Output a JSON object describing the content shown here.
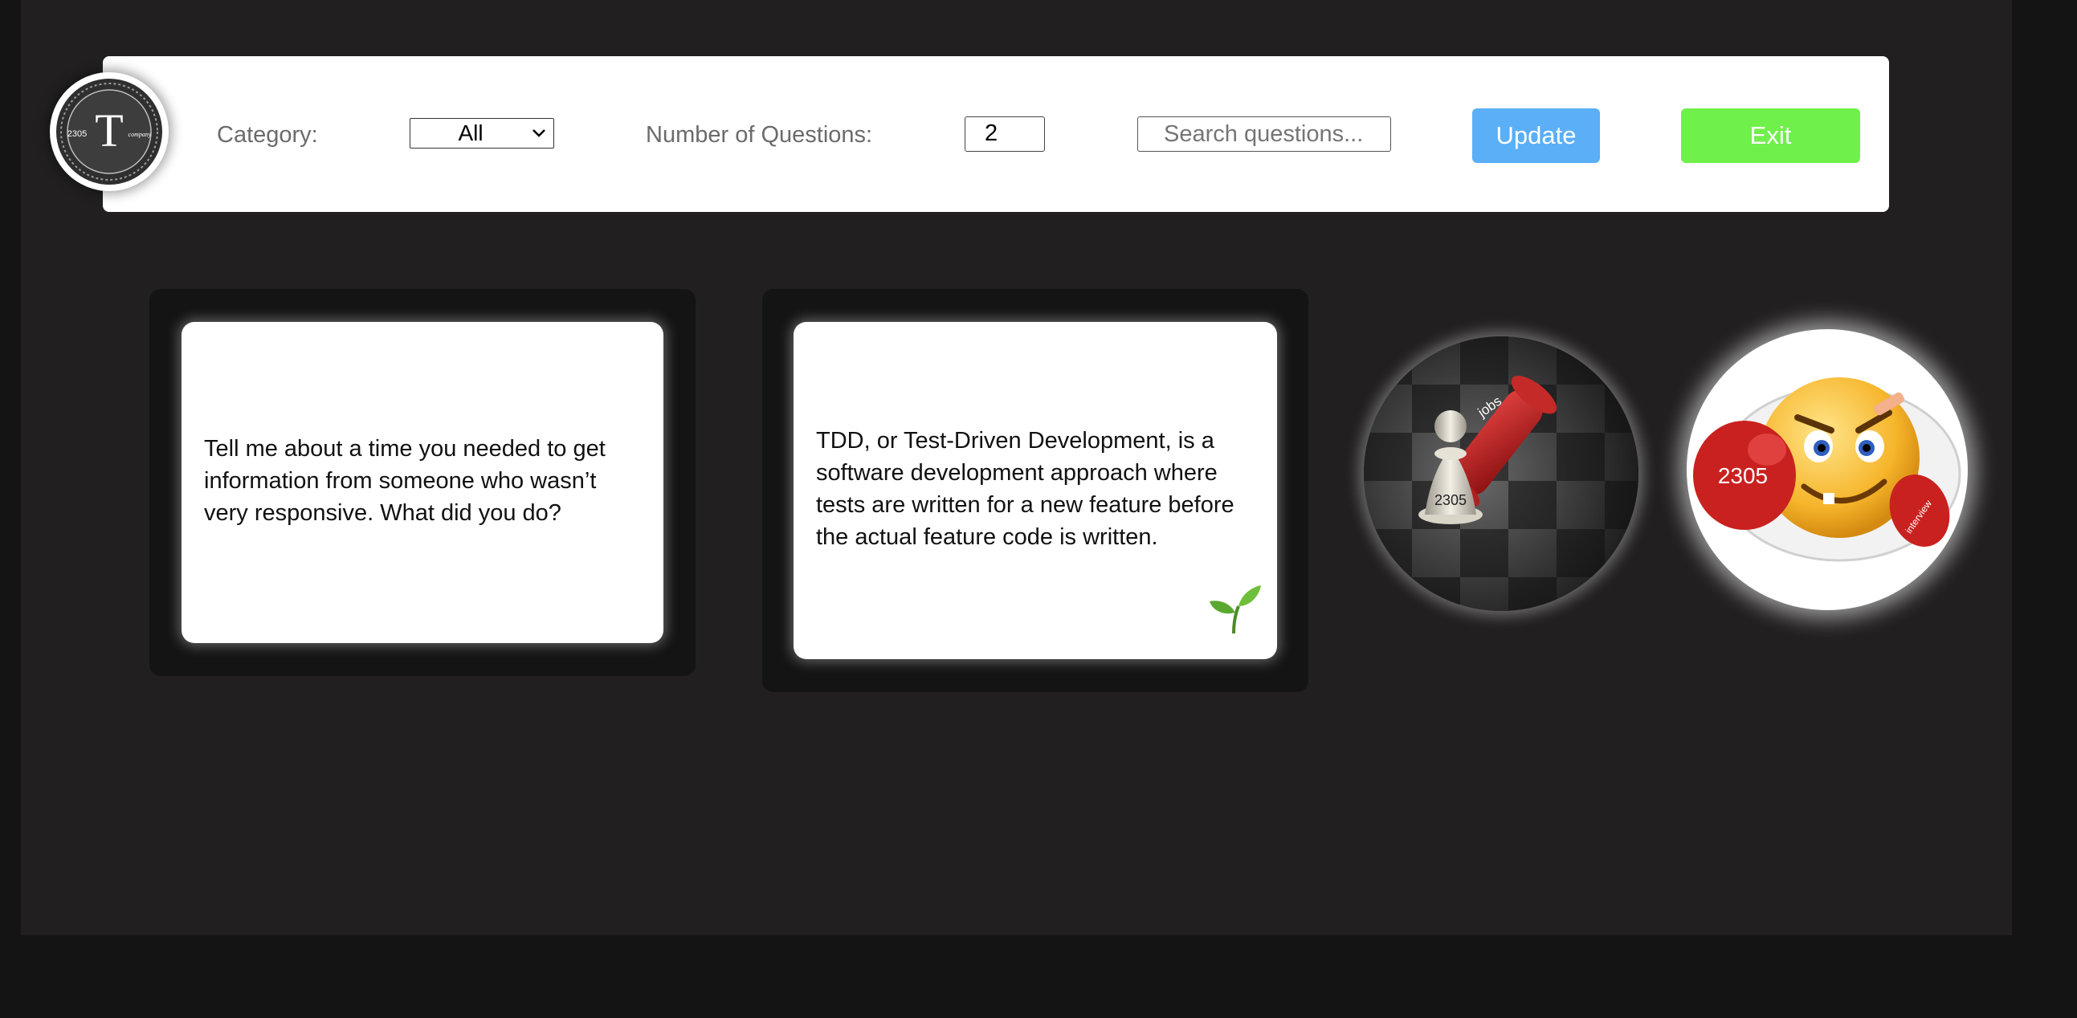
{
  "header": {
    "logo": {
      "letter": "T",
      "left_text": "2305",
      "right_text": "company"
    },
    "category_label": "Category:",
    "category_selected": "All",
    "num_questions_label": "Number of Questions:",
    "num_questions_value": "2",
    "search_placeholder": "Search questions...",
    "update_label": "Update",
    "exit_label": "Exit"
  },
  "cards": [
    {
      "text": "Tell me about a time you needed to get information from someone who wasn’t very responsive. What did you do?"
    },
    {
      "text": "TDD, or Test-Driven Development, is a software development approach where tests are written for a new feature before the actual feature code is written.",
      "icon": "sprout-icon"
    }
  ],
  "images": {
    "chess": {
      "pawn_label": "2305",
      "king_label": "jobs"
    },
    "smiley": {
      "glove_label": "2305",
      "right_glove_label": "interview"
    }
  },
  "colors": {
    "page_background": "#141414",
    "app_background": "#211f20",
    "update_button": "#5aaff6",
    "exit_button": "#6ff04a",
    "card_frame": "#141414"
  }
}
